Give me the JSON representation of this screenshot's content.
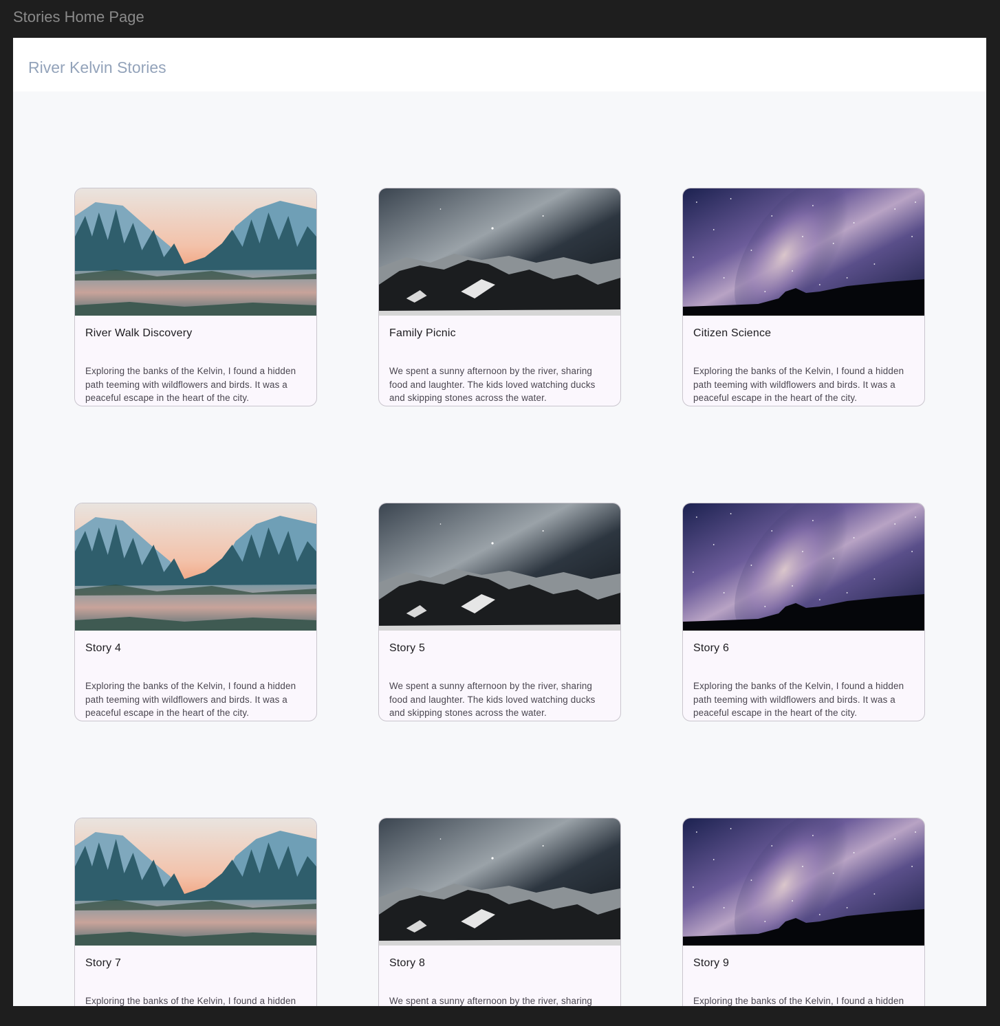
{
  "window": {
    "title": "Stories Home Page"
  },
  "app_bar": {
    "title": "River Kelvin Stories"
  },
  "stories": [
    {
      "title": "River Walk Discovery",
      "text": "Exploring the banks of the Kelvin, I found a hidden path teeming with wildflowers and birds. It was a peaceful escape in the heart of the city.",
      "image": "river-valley-image"
    },
    {
      "title": "Family Picnic",
      "text": "We spent a sunny afternoon by the river, sharing food and laughter. The kids loved watching ducks and skipping stones across the water.",
      "image": "mountain-night-image"
    },
    {
      "title": "Citizen Science",
      "text": "Exploring the banks of the Kelvin, I found a hidden path teeming with wildflowers and birds. It was a peaceful escape in the heart of the city.",
      "image": "milky-way-image"
    },
    {
      "title": "Story 4",
      "text": "Exploring the banks of the Kelvin, I found a hidden path teeming with wildflowers and birds. It was a peaceful escape in the heart of the city.",
      "image": "river-valley-image"
    },
    {
      "title": "Story 5",
      "text": "We spent a sunny afternoon by the river, sharing food and laughter. The kids loved watching ducks and skipping stones across the water.",
      "image": "mountain-night-image"
    },
    {
      "title": "Story 6",
      "text": "Exploring the banks of the Kelvin, I found a hidden path teeming with wildflowers and birds. It was a peaceful escape in the heart of the city.",
      "image": "milky-way-image"
    },
    {
      "title": "Story 7",
      "text": "Exploring the banks of the Kelvin, I found a hidden path teeming with wildflowers and birds. It was a peaceful escape in the heart of the city.",
      "image": "river-valley-image"
    },
    {
      "title": "Story 8",
      "text": "We spent a sunny afternoon by the river, sharing food and laughter. The kids loved watching ducks and skipping stones across the water.",
      "image": "mountain-night-image"
    },
    {
      "title": "Story 9",
      "text": "Exploring the banks of the Kelvin, I found a hidden path teeming with wildflowers and birds. It was a peaceful escape in the heart of the city.",
      "image": "milky-way-image"
    }
  ],
  "colors": {
    "chrome": "#1e1e1e",
    "page_background": "#f7f8fa",
    "app_bar": "#ffffff",
    "app_title": "#93a3ba",
    "card_background": "#fbf7fd",
    "card_border": "#c9c5cd"
  }
}
